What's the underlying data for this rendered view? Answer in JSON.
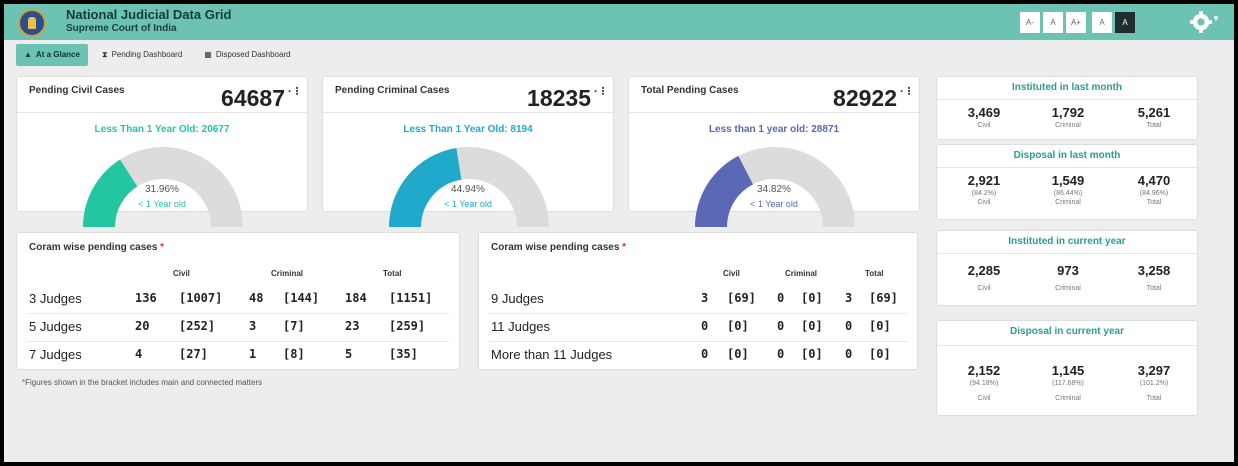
{
  "header": {
    "title": "National Judicial Data Grid",
    "subtitle": "Supreme Court of India",
    "font_controls": [
      "A-",
      "A",
      "A+",
      "A",
      "A"
    ]
  },
  "tabs": [
    {
      "label": "At a Glance",
      "icon": "bell-icon",
      "active": true
    },
    {
      "label": "Pending Dashboard",
      "icon": "hourglass-icon",
      "active": false
    },
    {
      "label": "Disposed Dashboard",
      "icon": "book-icon",
      "active": false
    }
  ],
  "pending_cards": [
    {
      "title": "Pending Civil Cases",
      "count": "64687",
      "less_text": "Less Than 1 Year Old: 20677",
      "percent_label": "31.96%",
      "fraction": 0.3196,
      "sub": "< 1 Year old",
      "color": "#22c7a2"
    },
    {
      "title": "Pending Criminal Cases",
      "count": "18235",
      "less_text": "Less Than 1 Year Old: 8194",
      "percent_label": "44.94%",
      "fraction": 0.4494,
      "sub": "< 1 Year old",
      "color": "#21a9cc"
    },
    {
      "title": "Total Pending Cases",
      "count": "82922",
      "less_text": "Less than 1 year old: 28871",
      "percent_label": "34.82%",
      "fraction": 0.3482,
      "sub": "< 1 Year old",
      "color": "#5a68b5"
    }
  ],
  "coram_left": {
    "title": "Coram wise pending cases",
    "required_mark": "*",
    "headers": {
      "civil": "Civil",
      "criminal": "Criminal",
      "total": "Total"
    },
    "rows": [
      {
        "label": "3 Judges",
        "civil": "136",
        "civil_b": "[1007]",
        "criminal": "48",
        "criminal_b": "[144]",
        "total": "184",
        "total_b": "[1151]"
      },
      {
        "label": "5 Judges",
        "civil": "20",
        "civil_b": "[252]",
        "criminal": "3",
        "criminal_b": "[7]",
        "total": "23",
        "total_b": "[259]"
      },
      {
        "label": "7 Judges",
        "civil": "4",
        "civil_b": "[27]",
        "criminal": "1",
        "criminal_b": "[8]",
        "total": "5",
        "total_b": "[35]"
      }
    ]
  },
  "coram_right": {
    "title": "Coram wise pending cases",
    "required_mark": "*",
    "headers": {
      "civil": "Civil",
      "criminal": "Criminal",
      "total": "Total"
    },
    "rows": [
      {
        "label": "9 Judges",
        "civil": "3",
        "civil_b": "[69]",
        "criminal": "0",
        "criminal_b": "[0]",
        "total": "3",
        "total_b": "[69]"
      },
      {
        "label": "11 Judges",
        "civil": "0",
        "civil_b": "[0]",
        "criminal": "0",
        "criminal_b": "[0]",
        "total": "0",
        "total_b": "[0]"
      },
      {
        "label": "More than 11 Judges",
        "civil": "0",
        "civil_b": "[0]",
        "criminal": "0",
        "criminal_b": "[0]",
        "total": "0",
        "total_b": "[0]"
      }
    ]
  },
  "footnote": {
    "mark": "*",
    "text": "Figures shown in the bracket includes main and connected matters"
  },
  "stats": {
    "instituted_last_month": {
      "title": "Instituted in last month",
      "civil": "3,469",
      "criminal": "1,792",
      "total": "5,261",
      "civil_label": "Civil",
      "criminal_label": "Criminal",
      "total_label": "Total"
    },
    "disposal_last_month": {
      "title": "Disposal in last month",
      "civil": "2,921",
      "criminal": "1,549",
      "total": "4,470",
      "civil_pct": "(84.2%)",
      "criminal_pct": "(86.44%)",
      "total_pct": "(84.96%)",
      "civil_label": "Civil",
      "criminal_label": "Criminal",
      "total_label": "Total"
    },
    "instituted_current_year": {
      "title": "Instituted in current year",
      "civil": "2,285",
      "criminal": "973",
      "total": "3,258",
      "civil_label": "Civil",
      "criminal_label": "Criminal",
      "total_label": "Total"
    },
    "disposal_current_year": {
      "title": "Disposal in current year",
      "civil": "2,152",
      "criminal": "1,145",
      "total": "3,297",
      "civil_pct": "(94.18%)",
      "criminal_pct": "(117.68%)",
      "total_pct": "(101.2%)",
      "civil_label": "Civil",
      "criminal_label": "Criminal",
      "total_label": "Total"
    }
  },
  "colors": {
    "header": "#6cc3b3",
    "accent_text": "#2a9d90",
    "gauge_track": "#dcdcdc"
  }
}
